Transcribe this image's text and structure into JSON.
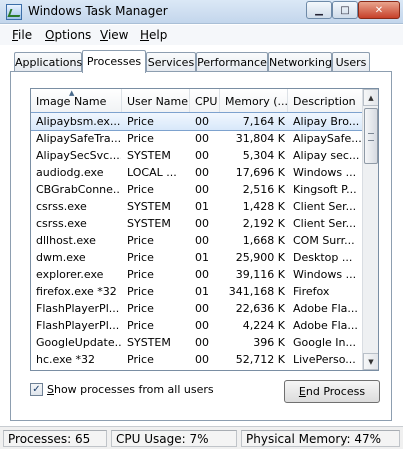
{
  "window": {
    "title": "Windows Task Manager",
    "controls": {
      "minimize": "▁",
      "maximize": "□",
      "close": "✕"
    }
  },
  "menu": [
    {
      "label": "File",
      "accel": "F",
      "rest": "ile"
    },
    {
      "label": "Options",
      "accel": "O",
      "rest": "ptions"
    },
    {
      "label": "View",
      "accel": "V",
      "rest": "iew"
    },
    {
      "label": "Help",
      "accel": "H",
      "rest": "elp"
    }
  ],
  "tabs": [
    {
      "label": "Applications",
      "active": false
    },
    {
      "label": "Processes",
      "active": true
    },
    {
      "label": "Services",
      "active": false
    },
    {
      "label": "Performance",
      "active": false
    },
    {
      "label": "Networking",
      "active": false
    },
    {
      "label": "Users",
      "active": false
    }
  ],
  "table": {
    "columns": [
      "Image Name",
      "User Name",
      "CPU",
      "Memory (...",
      "Description"
    ],
    "sorted_column": "Image Name",
    "rows": [
      {
        "name": "Alipaybsm.ex...",
        "user": "Price",
        "cpu": "00",
        "mem": "7,164 K",
        "desc": "Alipay Bro...",
        "selected": true
      },
      {
        "name": "AlipaySafeTra...",
        "user": "Price",
        "cpu": "00",
        "mem": "31,804 K",
        "desc": "AlipaySafe..."
      },
      {
        "name": "AlipaySecSvc....",
        "user": "SYSTEM",
        "cpu": "00",
        "mem": "5,304 K",
        "desc": "Alipay sec..."
      },
      {
        "name": "audiodg.exe",
        "user": "LOCAL ...",
        "cpu": "00",
        "mem": "17,696 K",
        "desc": "Windows ..."
      },
      {
        "name": "CBGrabConne...",
        "user": "Price",
        "cpu": "00",
        "mem": "2,516 K",
        "desc": "Kingsoft P..."
      },
      {
        "name": "csrss.exe",
        "user": "SYSTEM",
        "cpu": "01",
        "mem": "1,428 K",
        "desc": "Client Ser..."
      },
      {
        "name": "csrss.exe",
        "user": "SYSTEM",
        "cpu": "00",
        "mem": "2,192 K",
        "desc": "Client Ser..."
      },
      {
        "name": "dllhost.exe",
        "user": "Price",
        "cpu": "00",
        "mem": "1,668 K",
        "desc": "COM Surr..."
      },
      {
        "name": "dwm.exe",
        "user": "Price",
        "cpu": "01",
        "mem": "25,900 K",
        "desc": "Desktop ..."
      },
      {
        "name": "explorer.exe",
        "user": "Price",
        "cpu": "00",
        "mem": "39,116 K",
        "desc": "Windows ..."
      },
      {
        "name": "firefox.exe *32",
        "user": "Price",
        "cpu": "01",
        "mem": "341,168 K",
        "desc": "Firefox"
      },
      {
        "name": "FlashPlayerPl...",
        "user": "Price",
        "cpu": "00",
        "mem": "22,636 K",
        "desc": "Adobe Fla..."
      },
      {
        "name": "FlashPlayerPl...",
        "user": "Price",
        "cpu": "00",
        "mem": "4,224 K",
        "desc": "Adobe Fla..."
      },
      {
        "name": "GoogleUpdate...",
        "user": "SYSTEM",
        "cpu": "00",
        "mem": "396 K",
        "desc": "Google In..."
      },
      {
        "name": "hc.exe *32",
        "user": "Price",
        "cpu": "00",
        "mem": "52,712 K",
        "desc": "LivePerso..."
      }
    ]
  },
  "show_all": {
    "label": "Show processes from all users",
    "accel": "S",
    "rest": "how processes from all users",
    "checked": true
  },
  "end_process": {
    "label": "End Process",
    "accel": "E",
    "rest": "nd Process"
  },
  "status": {
    "processes": "Processes: 65",
    "cpu": "CPU Usage: 7%",
    "memory": "Physical Memory: 47%"
  }
}
